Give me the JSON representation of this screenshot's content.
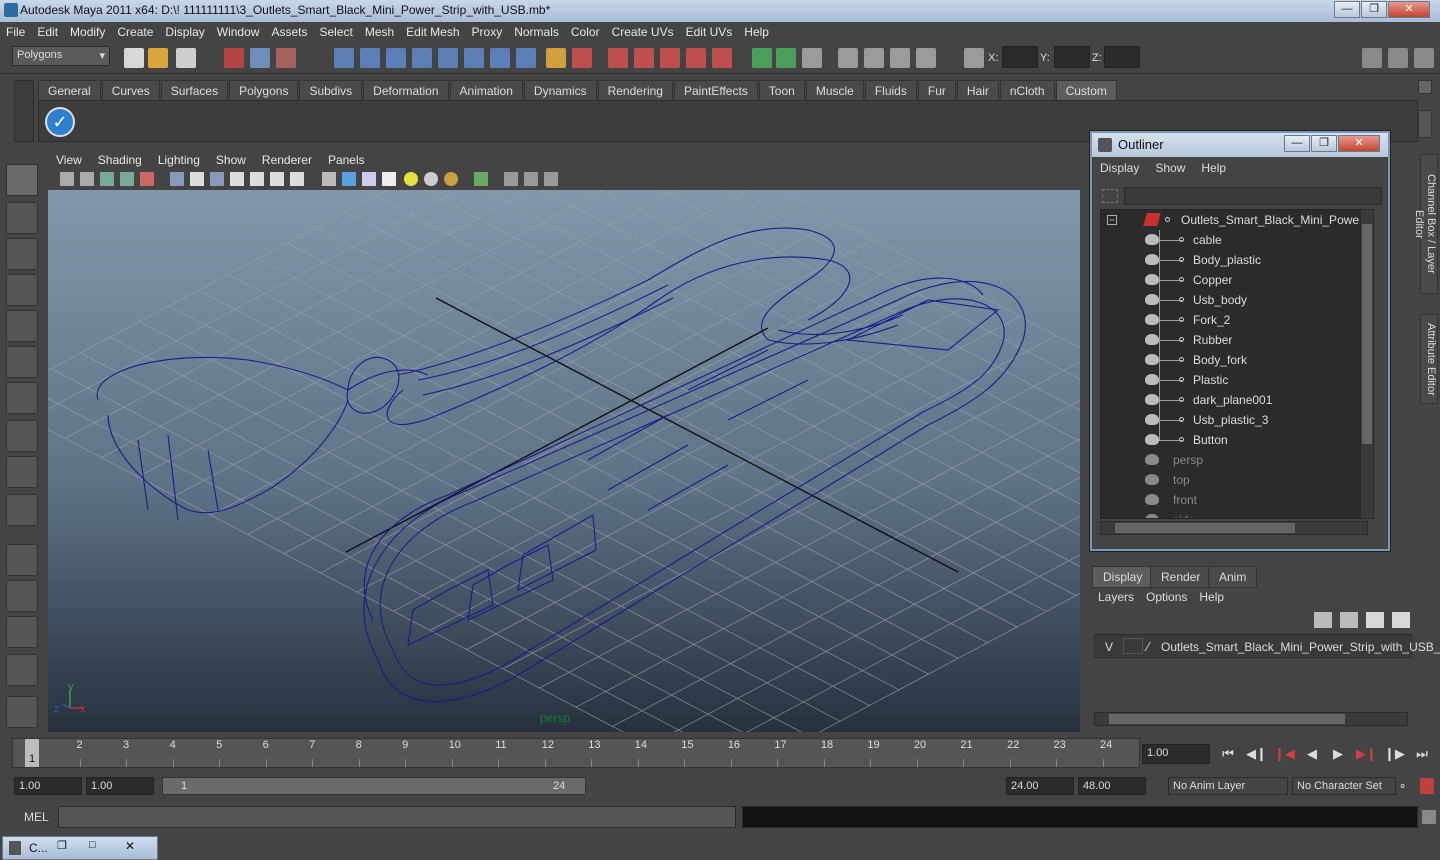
{
  "window": {
    "title": "Autodesk Maya 2011 x64: D:\\! 111111111\\3_Outlets_Smart_Black_Mini_Power_Strip_with_USB.mb*"
  },
  "menubar": [
    "File",
    "Edit",
    "Modify",
    "Create",
    "Display",
    "Window",
    "Assets",
    "Select",
    "Mesh",
    "Edit Mesh",
    "Proxy",
    "Normals",
    "Color",
    "Create UVs",
    "Edit UVs",
    "Help"
  ],
  "status": {
    "mode": "Polygons",
    "x_label": "X:",
    "y_label": "Y:",
    "z_label": "Z:"
  },
  "shelf": {
    "tabs": [
      "General",
      "Curves",
      "Surfaces",
      "Polygons",
      "Subdivs",
      "Deformation",
      "Animation",
      "Dynamics",
      "Rendering",
      "PaintEffects",
      "Toon",
      "Muscle",
      "Fluids",
      "Fur",
      "Hair",
      "nCloth",
      "Custom"
    ],
    "active_tab": "Custom"
  },
  "viewport": {
    "menus": [
      "View",
      "Shading",
      "Lighting",
      "Show",
      "Renderer",
      "Panels"
    ],
    "camera_label": "persp",
    "axis_y": "y",
    "axis_z": "z",
    "axis_x": "x"
  },
  "outliner": {
    "title": "Outliner",
    "menus": [
      "Display",
      "Show",
      "Help"
    ],
    "root": "Outlets_Smart_Black_Mini_Power_Strip_",
    "children": [
      "cable",
      "Body_plastic",
      "Copper",
      "Usb_body",
      "Fork_2",
      "Rubber",
      "Body_fork",
      "Plastic",
      "dark_plane001",
      "Usb_plastic_3",
      "Button"
    ],
    "cameras": [
      "persp",
      "top",
      "front",
      "side"
    ]
  },
  "layers": {
    "tabs": [
      "Display",
      "Render",
      "Anim"
    ],
    "active_tab": "Display",
    "menus": [
      "Layers",
      "Options",
      "Help"
    ],
    "layer_visible": "V",
    "layer_name": "Outlets_Smart_Black_Mini_Power_Strip_with_USB_l"
  },
  "side_tabs": [
    "Channel Box / Layer Editor",
    "Attribute Editor"
  ],
  "timeline": {
    "ticks": [
      1,
      2,
      3,
      4,
      5,
      6,
      7,
      8,
      9,
      10,
      11,
      12,
      13,
      14,
      15,
      16,
      17,
      18,
      19,
      20,
      21,
      22,
      23,
      24
    ],
    "current_frame": "1",
    "current_time": "1.00"
  },
  "range": {
    "start_outer": "1.00",
    "start_inner": "1.00",
    "slider_start": "1",
    "slider_end": "24",
    "end_inner": "24.00",
    "end_outer": "48.00",
    "anim_layer": "No Anim Layer",
    "character_set": "No Character Set"
  },
  "cmdline": {
    "label": "MEL"
  },
  "taskbar": {
    "item": "C..."
  },
  "colors": {
    "wireframe": "#1a1a8c",
    "accent": "#7d95b5"
  }
}
